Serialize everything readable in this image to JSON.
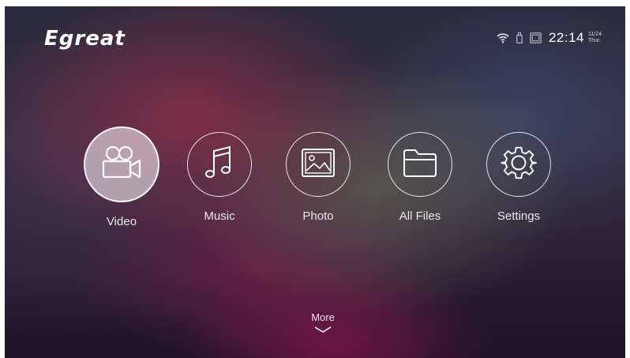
{
  "header": {
    "brand": "Egreat"
  },
  "status_bar": {
    "icons": [
      "wifi-icon",
      "usb-icon",
      "sd-card-icon"
    ],
    "time": "22:14",
    "date": "11/24",
    "weekday": "Thur."
  },
  "menu": {
    "items": [
      {
        "label": "Video",
        "icon": "video-camera-icon",
        "selected": true
      },
      {
        "label": "Music",
        "icon": "music-note-icon",
        "selected": false
      },
      {
        "label": "Photo",
        "icon": "photo-icon",
        "selected": false
      },
      {
        "label": "All Files",
        "icon": "folder-icon",
        "selected": false
      },
      {
        "label": "Settings",
        "icon": "gear-icon",
        "selected": false
      }
    ]
  },
  "more": {
    "label": "More",
    "icon": "chevron-down-icon"
  },
  "colors": {
    "text": "#ffffff",
    "selected_fill": "#ffffff8c"
  }
}
